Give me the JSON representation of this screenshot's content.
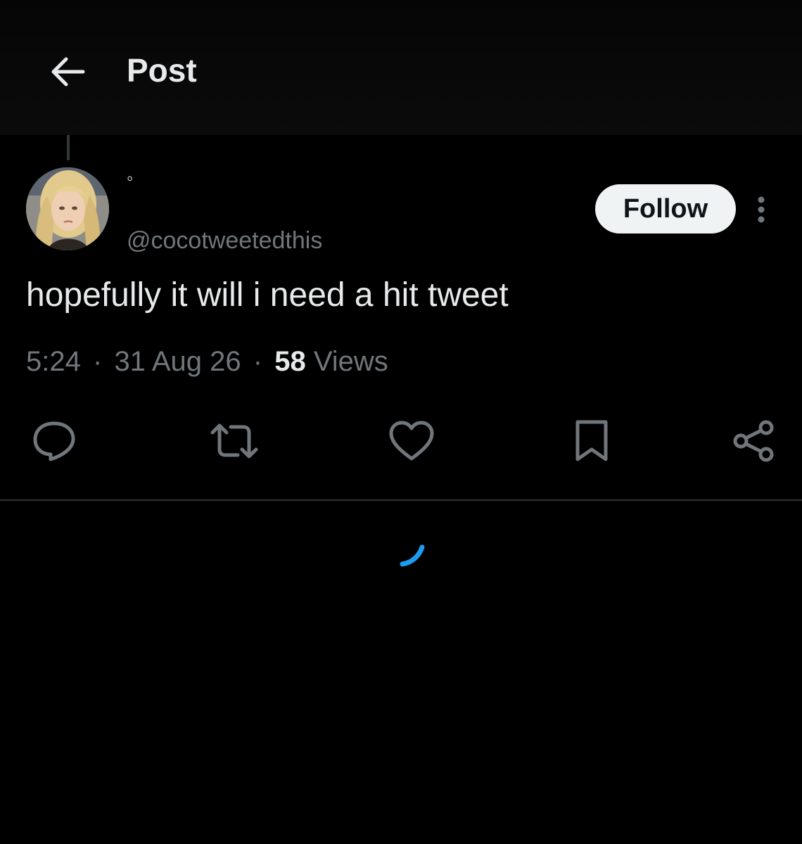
{
  "header": {
    "title": "Post",
    "back_icon": "arrow-left-icon"
  },
  "author": {
    "display_name": "◦",
    "handle": "@cocotweetedthis",
    "follow_label": "Follow",
    "more_icon": "more-vertical-icon"
  },
  "tweet": {
    "text": "hopefully it will i need a hit tweet",
    "time": "5:24",
    "date": "31 Aug 26",
    "views_count": "58",
    "views_label": "Views",
    "separator": "·"
  },
  "actions": [
    {
      "icon": "reply-icon"
    },
    {
      "icon": "retweet-icon"
    },
    {
      "icon": "like-icon"
    },
    {
      "icon": "bookmark-icon"
    },
    {
      "icon": "share-icon"
    }
  ],
  "colors": {
    "background": "#000000",
    "text_primary": "#e7e9ea",
    "text_secondary": "#71767b",
    "follow_bg": "#eff3f4",
    "accent": "#1d9bf0",
    "divider": "#2f3336"
  }
}
